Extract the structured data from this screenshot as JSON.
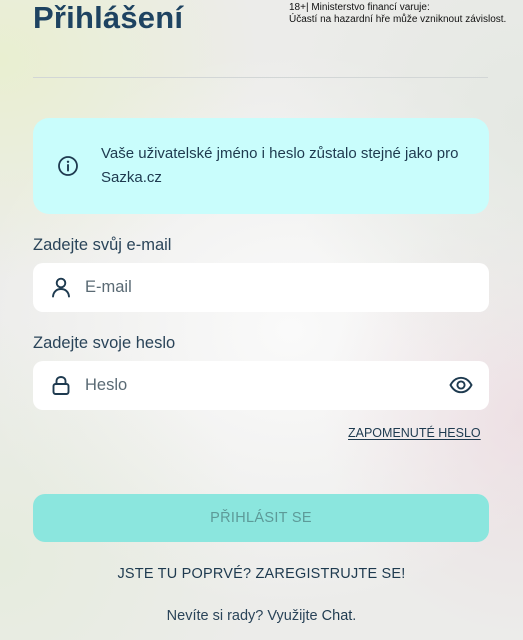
{
  "header": {
    "title": "Přihlášení",
    "warning_line1": "18+| Ministerstvo financí varuje:",
    "warning_line2": "Účastí na hazardní hře může vzniknout závislost."
  },
  "info_box": {
    "icon": "info-circle-icon",
    "text": "Vaše uživatelské jméno i heslo zůstalo stejné jako pro Sazka.cz",
    "background": "#c9fdfc"
  },
  "email": {
    "label": "Zadejte svůj e-mail",
    "placeholder": "E-mail",
    "value": "",
    "icon": "user-icon"
  },
  "password": {
    "label": "Zadejte svoje heslo",
    "placeholder": "Heslo",
    "value": "",
    "icon": "lock-icon",
    "toggle_icon": "eye-icon"
  },
  "forgot_password": "ZAPOMENUTÉ HESLO",
  "submit": {
    "label": "PŘIHLÁSIT SE",
    "background": "#8be6de"
  },
  "register": {
    "prompt": "JSTE TU POPRVÉ? ",
    "link": "ZAREGISTRUJTE SE!"
  },
  "help": {
    "prefix": "Nevíte si rady? Využijte ",
    "link": "Chat",
    "suffix": "."
  }
}
